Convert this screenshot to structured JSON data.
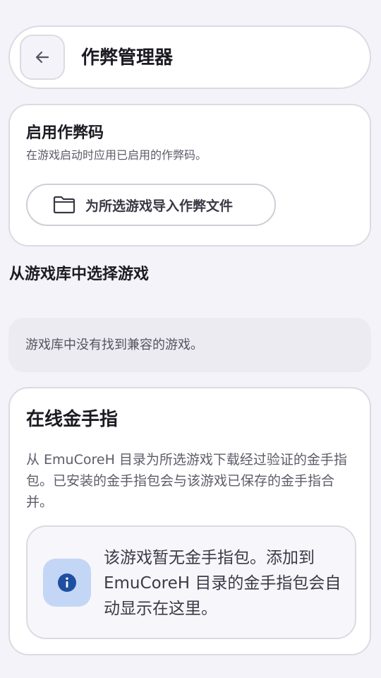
{
  "header": {
    "title": "作弊管理器",
    "back_icon": "arrow-left-icon"
  },
  "cheats": {
    "title": "启用作弊码",
    "description": "在游戏启动时应用已启用的作弊码。",
    "import_label": "为所选游戏导入作弊文件",
    "import_icon": "folder-icon"
  },
  "library": {
    "heading": "从游戏库中选择游戏",
    "empty_text": "游戏库中没有找到兼容的游戏。"
  },
  "online": {
    "title": "在线金手指",
    "description": "从 EmuCoreH 目录为所选游戏下载经过验证的金手指包。已安装的金手指包会与该游戏已保存的金手指合并。",
    "info_text": "该游戏暂无金手指包。添加到 EmuCoreH 目录的金手指包会自动显示在这里。",
    "info_icon": "info-icon",
    "info_icon_color": "#1f4fa0"
  }
}
